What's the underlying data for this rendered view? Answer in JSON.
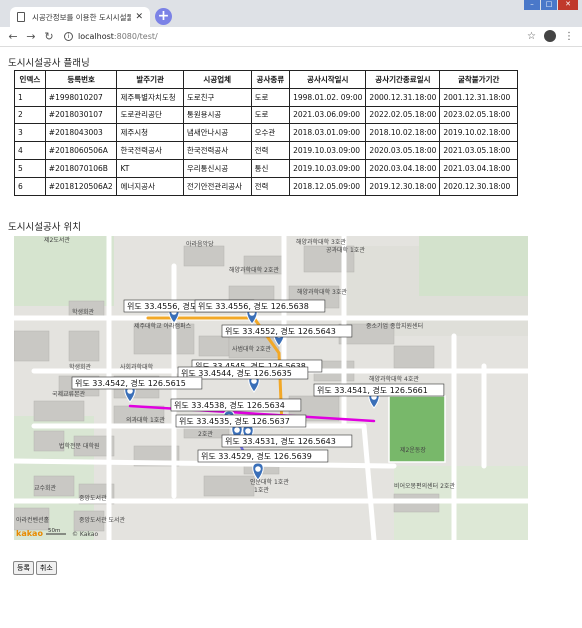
{
  "browser": {
    "tab_title": "시공간정보를 이용한 도시시설물",
    "url_host": "localhost",
    "url_path": ":8080/test/"
  },
  "page": {
    "list_title": "도시시설공사 플래닝",
    "map_title": "도시시설공사 위치"
  },
  "table": {
    "headers": [
      "인덱스",
      "등록번호",
      "발주기관",
      "시공업체",
      "공사종류",
      "공사시작일시",
      "공사기간종료일시",
      "굴착불가기간"
    ],
    "rows": [
      [
        "1",
        "#1998010207",
        "제주특별자치도청",
        "도로친구",
        "도로",
        "1998.01.02. 09:00",
        "2000.12.31.18:00",
        "2001.12.31.18:00"
      ],
      [
        "2",
        "#2018030107",
        "도로관리공단",
        "통원용시공",
        "도로",
        "2021.03.06.09:00",
        "2022.02.05.18:00",
        "2023.02.05.18:00"
      ],
      [
        "3",
        "#2018043003",
        "제주시청",
        "냄새안나시공",
        "오수관",
        "2018.03.01.09:00",
        "2018.10.02.18:00",
        "2019.10.02.18:00"
      ],
      [
        "4",
        "#2018060506A",
        "한국전력공사",
        "한국전력공사",
        "전력",
        "2019.10.03.09:00",
        "2020.03.05.18:00",
        "2021.03.05.18:00"
      ],
      [
        "5",
        "#2018070106B",
        "KT",
        "우리통신시공",
        "통신",
        "2019.10.03.09:00",
        "2020.03.04.18:00",
        "2021.03.04.18:00"
      ],
      [
        "6",
        "#2018120506A2",
        "에너지공사",
        "전기안전관리공사",
        "전력",
        "2018.12.05.09:00",
        "2019.12.30.18:00",
        "2020.12.30.18:00"
      ]
    ]
  },
  "map": {
    "buildings": [
      "제2도서관",
      "아라음악당",
      "해양과학대학\n3호관",
      "공과대학\n1호관",
      "해양과학대학\n2호관",
      "해양과학대학\n3호관",
      "제주대학교\n아라캠퍼스",
      "학생회관",
      "사범대학\n2호관",
      "중소기업\n종합지원센터",
      "학생회관",
      "사회과학대학",
      "의과대학\n1호관",
      "해양과학대학\n4호관",
      "국제교류본관",
      "2호관",
      "법학전문\n대학원",
      "제2운동장",
      "교수회관",
      "중앙도서관",
      "중앙도서관\n도서관",
      "1호관",
      "비어오몽편의센터\n2호관",
      "아라컨벤션홀",
      "인문대학\n1호관"
    ],
    "labels": [
      "위도 33.4556, 경도 126.5638",
      "위도 33.4556, 경도 126.5638",
      "위도 33.4552, 경도 126.5643",
      "위도 33.4545, 경도 126.5638",
      "위도 33.4544, 경도 126.5635",
      "위도 33.4542, 경도 126.5615",
      "위도 33.4541, 경도 126.5661",
      "위도 33.4538, 경도 126.5634",
      "위도 33.4535, 경도 126.5637",
      "위도 33.4531, 경도 126.5643",
      "위도 33.4529, 경도 126.5639"
    ],
    "attribution": "© Kakao",
    "scale": "50m",
    "logo": "kakao"
  },
  "buttons": {
    "register": "등록",
    "cancel": "취소"
  }
}
